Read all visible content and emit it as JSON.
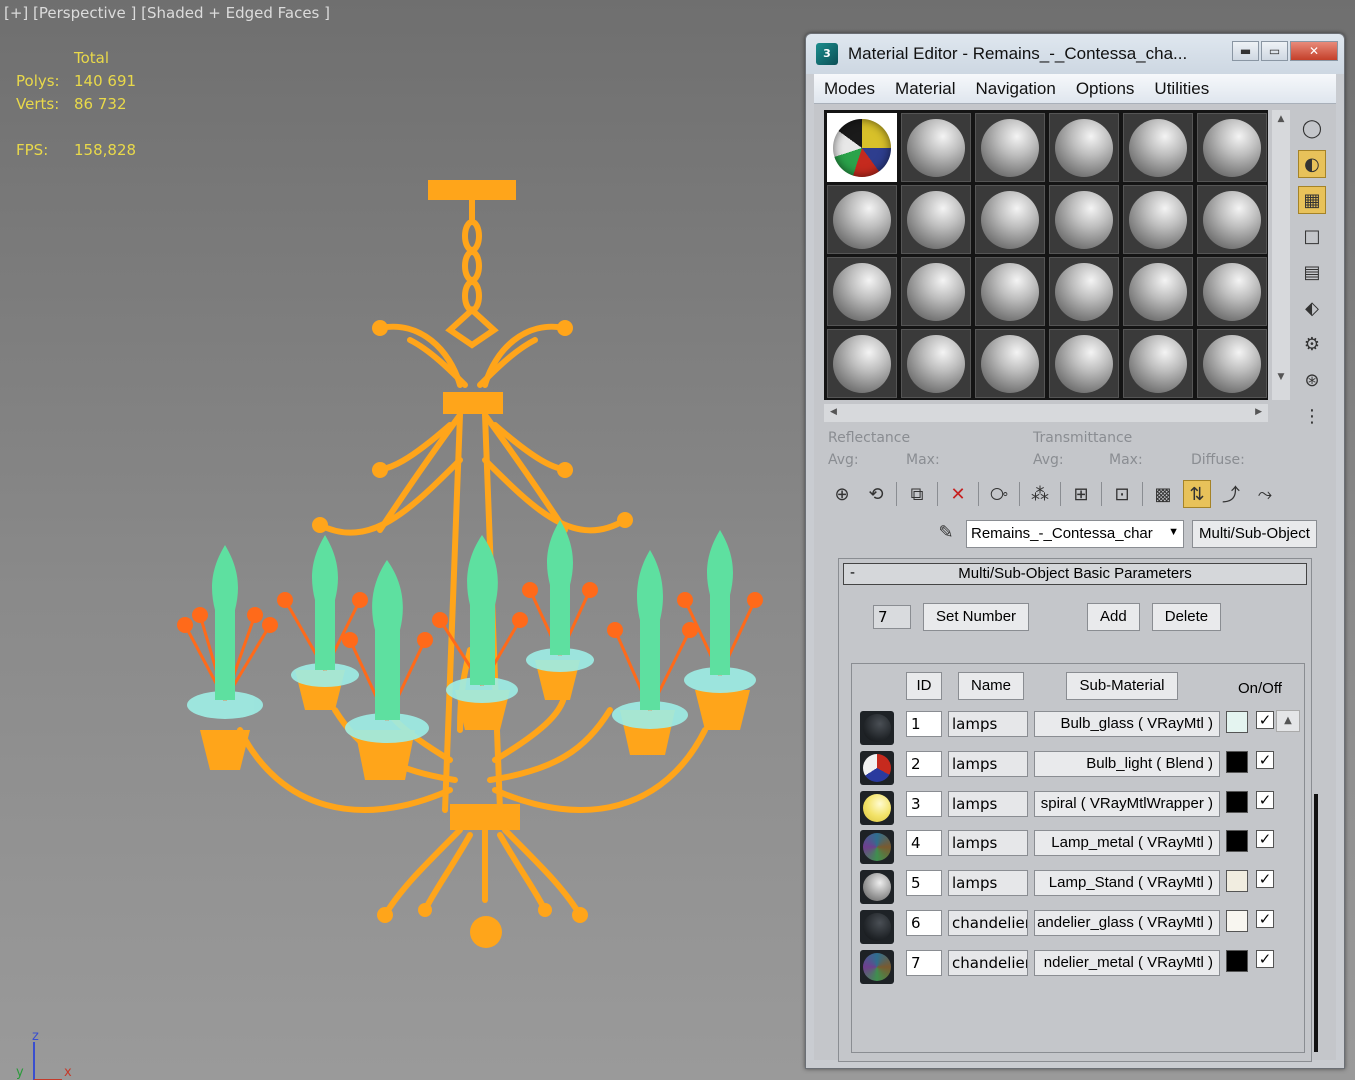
{
  "viewport": {
    "label": "[+] [Perspective ] [Shaded + Edged Faces ]",
    "stats": {
      "header": "Total",
      "polys_label": "Polys:",
      "polys_value": "140 691",
      "verts_label": "Verts:",
      "verts_value": "86 732",
      "fps_label": "FPS:",
      "fps_value": "158,828"
    },
    "axis": {
      "z": "z",
      "y": "y",
      "x": "x"
    },
    "colors": {
      "wire_metal": "#ffa51a",
      "bulbs": "#5ee0a0",
      "cups": "#9eeee6",
      "flowers": "#ff6a1a"
    }
  },
  "editor": {
    "title": "Material Editor - Remains_-_Contessa_cha...",
    "menu": [
      "Modes",
      "Material",
      "Navigation",
      "Options",
      "Utilities"
    ],
    "reflectance_label": "Reflectance",
    "transmittance_label": "Transmittance",
    "avg_label": "Avg:",
    "max_label": "Max:",
    "avg2_label": "Avg:",
    "max2_label": "Max:",
    "diffuse_label": "Diffuse:",
    "material_name": "Remains_-_Contessa_char",
    "material_type": "Multi/Sub-Object",
    "rollout_title": "Multi/Sub-Object Basic Parameters",
    "rollout_toggle": "-",
    "set_number_value": "7",
    "set_number_label": "Set Number",
    "add_label": "Add",
    "delete_label": "Delete",
    "col_id": "ID",
    "col_name": "Name",
    "col_sub": "Sub-Material",
    "col_onoff": "On/Off",
    "rows": [
      {
        "id": "1",
        "name": "lamps",
        "sub": "Bulb_glass ( VRayMtl )",
        "swatch": "#e4f4f0",
        "ball": "dark"
      },
      {
        "id": "2",
        "name": "lamps",
        "sub": "Bulb_light ( Blend )",
        "swatch": "#000000",
        "ball": "blend"
      },
      {
        "id": "3",
        "name": "lamps",
        "sub": "spiral ( VRayMtlWrapper )",
        "swatch": "#000000",
        "ball": "yellow"
      },
      {
        "id": "4",
        "name": "lamps",
        "sub": "Lamp_metal ( VRayMtl )",
        "swatch": "#000000",
        "ball": "noise"
      },
      {
        "id": "5",
        "name": "lamps",
        "sub": "Lamp_Stand ( VRayMtl )",
        "swatch": "#f1ede0",
        "ball": "grey"
      },
      {
        "id": "6",
        "name": "chandelier",
        "sub": "andelier_glass ( VRayMtl )",
        "swatch": "#f8f6f0",
        "ball": "dark"
      },
      {
        "id": "7",
        "name": "chandelier",
        "sub": "ndelier_metal ( VRayMtl )",
        "swatch": "#000000",
        "ball": "noise"
      }
    ],
    "check_mark": "✓"
  }
}
